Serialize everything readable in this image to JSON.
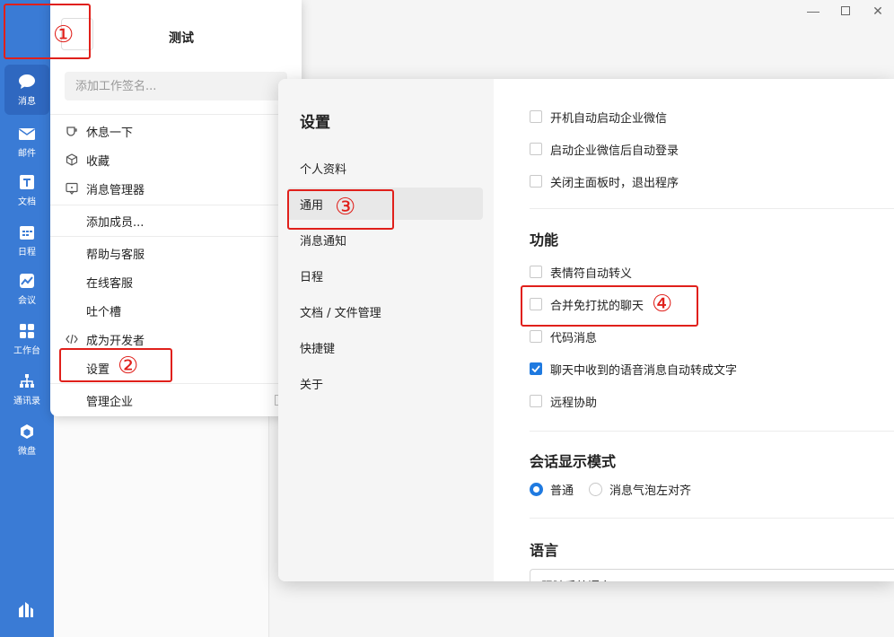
{
  "rail": {
    "items": [
      {
        "label": "消息",
        "icon": "chat-bubble-icon"
      },
      {
        "label": "邮件",
        "icon": "mail-icon"
      },
      {
        "label": "文档",
        "icon": "document-icon"
      },
      {
        "label": "日程",
        "icon": "calendar-icon"
      },
      {
        "label": "会议",
        "icon": "meeting-icon"
      },
      {
        "label": "工作台",
        "icon": "grid-icon"
      },
      {
        "label": "通讯录",
        "icon": "contacts-icon"
      },
      {
        "label": "微盘",
        "icon": "drive-icon"
      }
    ]
  },
  "popup": {
    "name": "测试",
    "signature_placeholder": "添加工作签名...",
    "items": [
      {
        "label": "休息一下",
        "icon": "cup-icon"
      },
      {
        "label": "收藏",
        "icon": "cube-icon"
      },
      {
        "label": "消息管理器",
        "icon": "message-manager-icon"
      },
      {
        "label": "添加成员..."
      },
      {
        "label": "帮助与客服"
      },
      {
        "label": "在线客服"
      },
      {
        "label": "吐个槽"
      },
      {
        "label": "成为开发者",
        "icon": "code-icon"
      },
      {
        "label": "设置"
      },
      {
        "label": "管理企业"
      }
    ]
  },
  "settings": {
    "title": "设置",
    "nav": [
      "个人资料",
      "通用",
      "消息通知",
      "日程",
      "文档 / 文件管理",
      "快捷键",
      "关于"
    ],
    "active_nav": "通用",
    "startup_options": [
      {
        "label": "开机自动启动企业微信",
        "checked": false
      },
      {
        "label": "启动企业微信后自动登录",
        "checked": false
      },
      {
        "label": "关闭主面板时，退出程序",
        "checked": false
      }
    ],
    "features_title": "功能",
    "features": [
      {
        "label": "表情符自动转义",
        "checked": false
      },
      {
        "label": "合并免打扰的聊天",
        "checked": false
      },
      {
        "label": "代码消息",
        "checked": false
      },
      {
        "label": "聊天中收到的语音消息自动转成文字",
        "checked": true
      },
      {
        "label": "远程协助",
        "checked": false
      }
    ],
    "display_mode_title": "会话显示模式",
    "display_modes": [
      {
        "label": "普通",
        "selected": true
      },
      {
        "label": "消息气泡左对齐",
        "selected": false
      }
    ],
    "language_title": "语言",
    "language_value": "跟随系统语言"
  },
  "annotations": [
    "①",
    "②",
    "③",
    "④"
  ],
  "colors": {
    "rail": "#3a7bd5",
    "accent": "#1f7ae0",
    "annotation": "#e0201b"
  }
}
